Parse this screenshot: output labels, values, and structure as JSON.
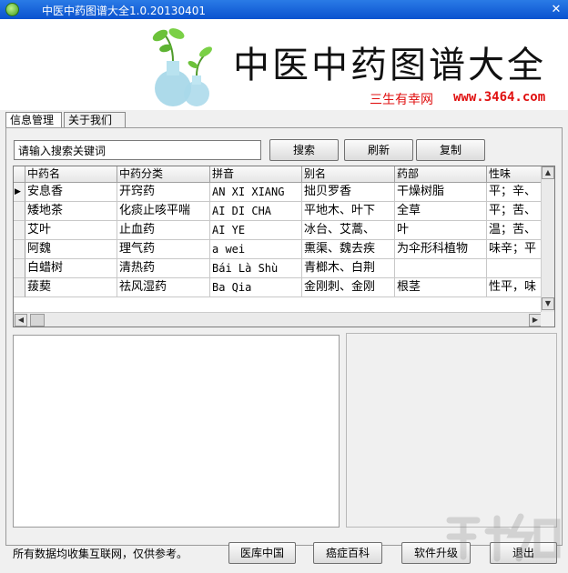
{
  "window": {
    "title": "中医中药图谱大全1.0.20130401",
    "close_glyph": "✕"
  },
  "banner": {
    "title": "中医中药图谱大全",
    "site_name": "三生有幸网",
    "site_url": "www.3464.com"
  },
  "tabs": [
    {
      "label": "信息管理",
      "active": true
    },
    {
      "label": "关于我们",
      "active": false
    }
  ],
  "search": {
    "value": "请输入搜索关键词",
    "search_label": "搜索",
    "refresh_label": "刷新",
    "copy_label": "复制"
  },
  "grid": {
    "columns": [
      "中药名",
      "中药分类",
      "拼音",
      "别名",
      "药部",
      "性味"
    ],
    "rows": [
      [
        "安息香",
        "开窍药",
        "AN XI XIANG",
        "拙贝罗香",
        "干燥树脂",
        "平；辛、"
      ],
      [
        "矮地茶",
        "化痰止咳平喘",
        "AI DI CHA",
        "平地木、叶下",
        "全草",
        "平；苦、"
      ],
      [
        "艾叶",
        "止血药",
        "AI YE",
        "冰台、艾蒿、",
        "叶",
        "温；苦、"
      ],
      [
        "阿魏",
        "理气药",
        "a wei",
        "熏渠、魏去疾",
        "为伞形科植物",
        "味辛；平"
      ],
      [
        "白蜡树",
        "清热药",
        "Bái Là Shù",
        "青榔木、白荆",
        "",
        ""
      ],
      [
        "菝葜",
        "祛风湿药",
        "Ba Qia",
        "金刚刺、金刚",
        "根茎",
        "性平，味"
      ]
    ],
    "current_row_marker": "▶",
    "scroll_up_icon": "▲",
    "scroll_down_icon": "▼",
    "scroll_left_icon": "◀",
    "scroll_right_icon": "▶"
  },
  "footer": {
    "status": "所有数据均收集互联网，仅供参考。",
    "buttons": [
      "医库中国",
      "癌症百科",
      "软件升级",
      "退出"
    ]
  },
  "colors": {
    "titlebar": "#0a52cf",
    "site_text": "#e01010"
  }
}
